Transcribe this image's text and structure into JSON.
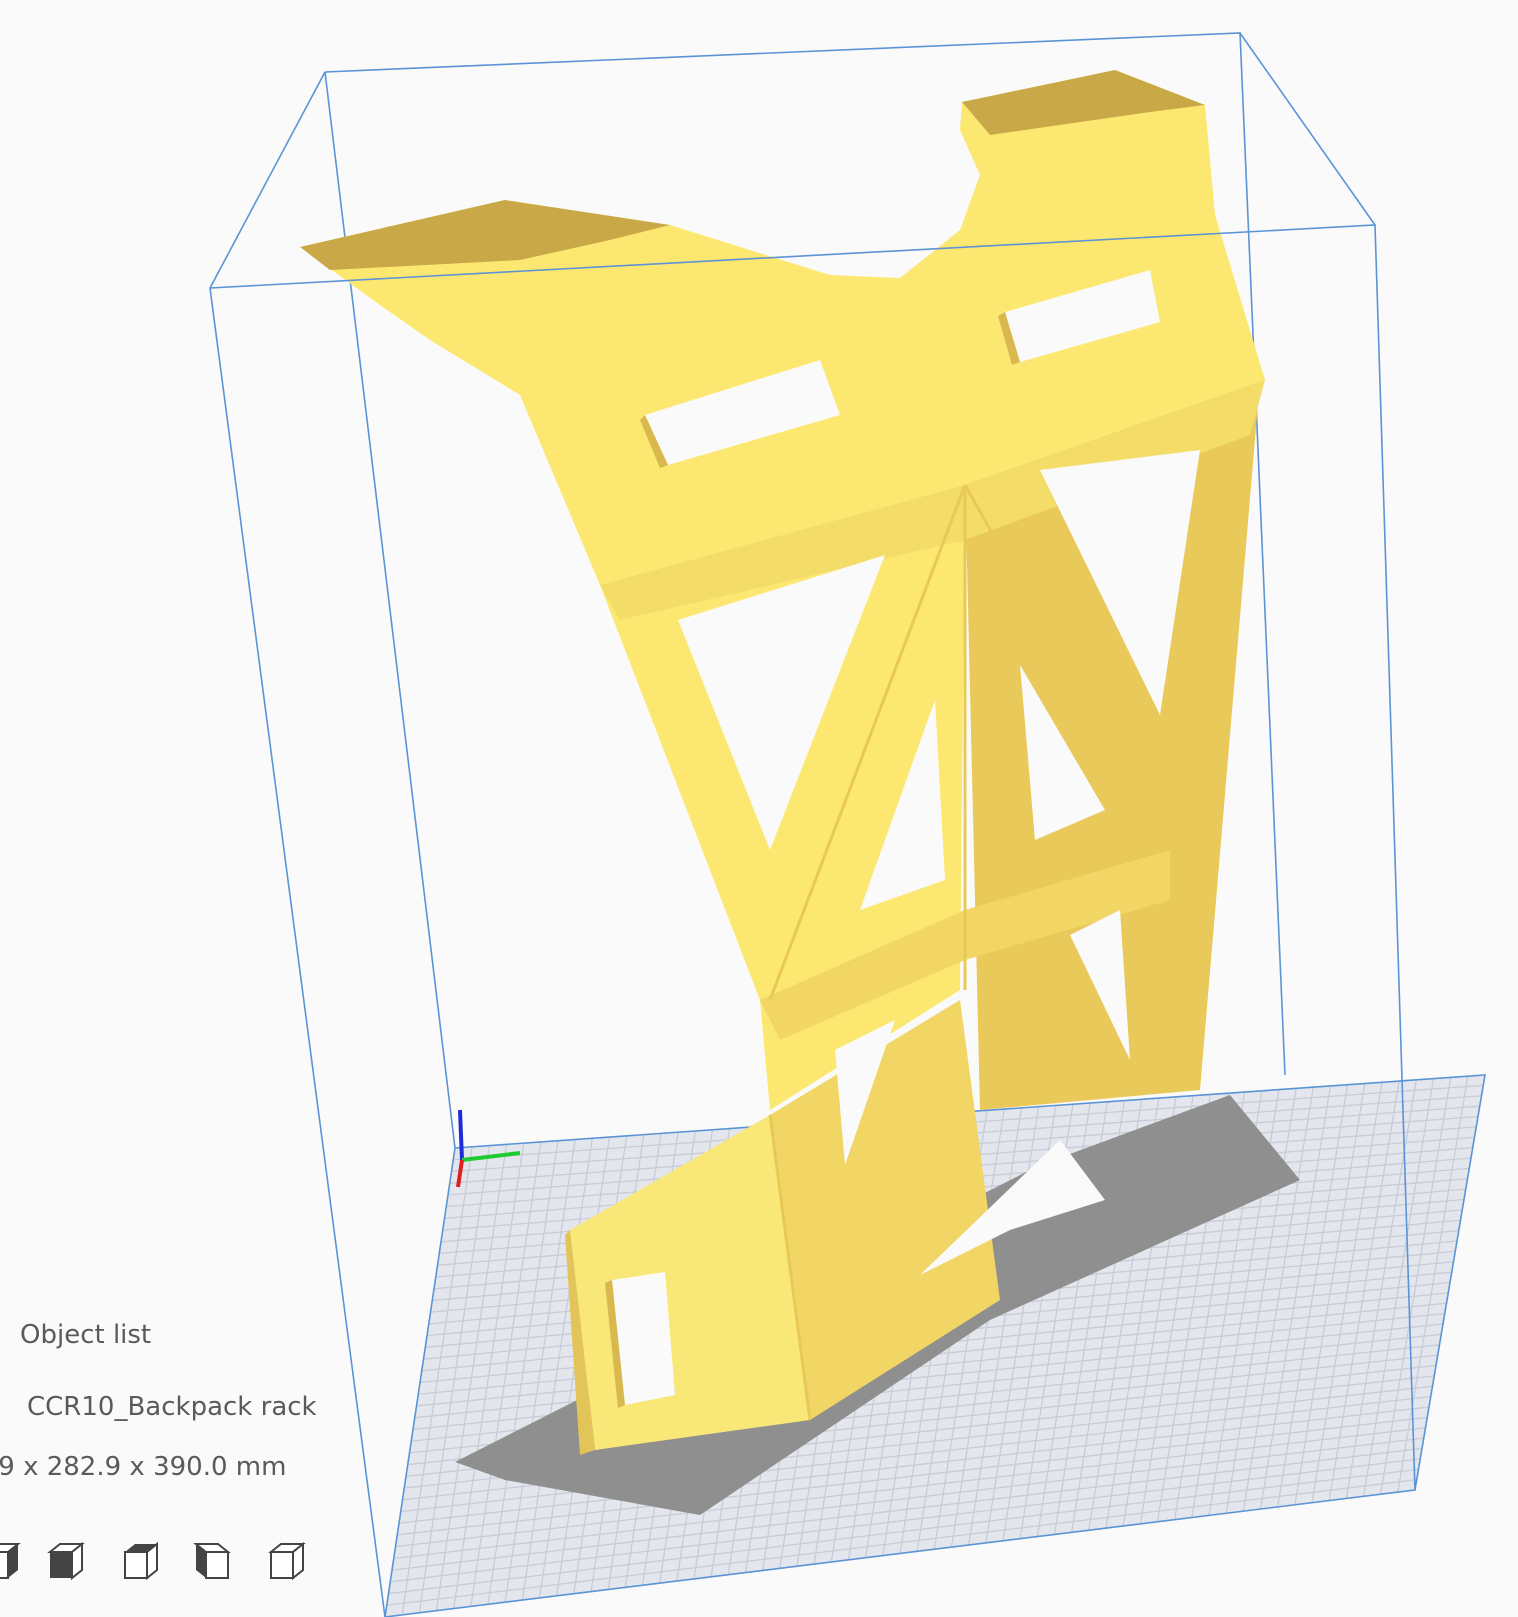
{
  "viewport": {
    "label": "3D build volume view",
    "model_color": "#f8e06a",
    "grid_color": "#cfd4de",
    "volume_outline_color": "#5b94d6",
    "shadow_color": "#8a8a8a"
  },
  "object_panel": {
    "title": "Object list",
    "object_name": "CCR10_Backpack rack",
    "dimensions": ".9 x 282.9 x 390.0 mm"
  },
  "view_buttons": [
    {
      "name": "3d-view-icon"
    },
    {
      "name": "front-view-icon"
    },
    {
      "name": "top-view-icon"
    },
    {
      "name": "left-view-icon"
    },
    {
      "name": "right-view-icon"
    }
  ]
}
